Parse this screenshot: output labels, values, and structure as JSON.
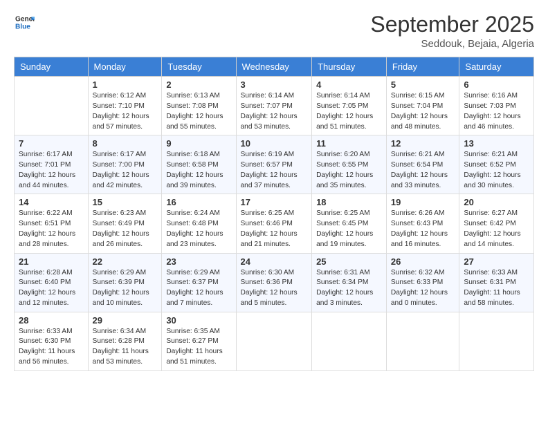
{
  "logo": {
    "line1": "General",
    "line2": "Blue"
  },
  "header": {
    "month": "September 2025",
    "location": "Seddouk, Bejaia, Algeria"
  },
  "weekdays": [
    "Sunday",
    "Monday",
    "Tuesday",
    "Wednesday",
    "Thursday",
    "Friday",
    "Saturday"
  ],
  "weeks": [
    [
      {
        "day": "",
        "info": ""
      },
      {
        "day": "1",
        "info": "Sunrise: 6:12 AM\nSunset: 7:10 PM\nDaylight: 12 hours\nand 57 minutes."
      },
      {
        "day": "2",
        "info": "Sunrise: 6:13 AM\nSunset: 7:08 PM\nDaylight: 12 hours\nand 55 minutes."
      },
      {
        "day": "3",
        "info": "Sunrise: 6:14 AM\nSunset: 7:07 PM\nDaylight: 12 hours\nand 53 minutes."
      },
      {
        "day": "4",
        "info": "Sunrise: 6:14 AM\nSunset: 7:05 PM\nDaylight: 12 hours\nand 51 minutes."
      },
      {
        "day": "5",
        "info": "Sunrise: 6:15 AM\nSunset: 7:04 PM\nDaylight: 12 hours\nand 48 minutes."
      },
      {
        "day": "6",
        "info": "Sunrise: 6:16 AM\nSunset: 7:03 PM\nDaylight: 12 hours\nand 46 minutes."
      }
    ],
    [
      {
        "day": "7",
        "info": "Sunrise: 6:17 AM\nSunset: 7:01 PM\nDaylight: 12 hours\nand 44 minutes."
      },
      {
        "day": "8",
        "info": "Sunrise: 6:17 AM\nSunset: 7:00 PM\nDaylight: 12 hours\nand 42 minutes."
      },
      {
        "day": "9",
        "info": "Sunrise: 6:18 AM\nSunset: 6:58 PM\nDaylight: 12 hours\nand 39 minutes."
      },
      {
        "day": "10",
        "info": "Sunrise: 6:19 AM\nSunset: 6:57 PM\nDaylight: 12 hours\nand 37 minutes."
      },
      {
        "day": "11",
        "info": "Sunrise: 6:20 AM\nSunset: 6:55 PM\nDaylight: 12 hours\nand 35 minutes."
      },
      {
        "day": "12",
        "info": "Sunrise: 6:21 AM\nSunset: 6:54 PM\nDaylight: 12 hours\nand 33 minutes."
      },
      {
        "day": "13",
        "info": "Sunrise: 6:21 AM\nSunset: 6:52 PM\nDaylight: 12 hours\nand 30 minutes."
      }
    ],
    [
      {
        "day": "14",
        "info": "Sunrise: 6:22 AM\nSunset: 6:51 PM\nDaylight: 12 hours\nand 28 minutes."
      },
      {
        "day": "15",
        "info": "Sunrise: 6:23 AM\nSunset: 6:49 PM\nDaylight: 12 hours\nand 26 minutes."
      },
      {
        "day": "16",
        "info": "Sunrise: 6:24 AM\nSunset: 6:48 PM\nDaylight: 12 hours\nand 23 minutes."
      },
      {
        "day": "17",
        "info": "Sunrise: 6:25 AM\nSunset: 6:46 PM\nDaylight: 12 hours\nand 21 minutes."
      },
      {
        "day": "18",
        "info": "Sunrise: 6:25 AM\nSunset: 6:45 PM\nDaylight: 12 hours\nand 19 minutes."
      },
      {
        "day": "19",
        "info": "Sunrise: 6:26 AM\nSunset: 6:43 PM\nDaylight: 12 hours\nand 16 minutes."
      },
      {
        "day": "20",
        "info": "Sunrise: 6:27 AM\nSunset: 6:42 PM\nDaylight: 12 hours\nand 14 minutes."
      }
    ],
    [
      {
        "day": "21",
        "info": "Sunrise: 6:28 AM\nSunset: 6:40 PM\nDaylight: 12 hours\nand 12 minutes."
      },
      {
        "day": "22",
        "info": "Sunrise: 6:29 AM\nSunset: 6:39 PM\nDaylight: 12 hours\nand 10 minutes."
      },
      {
        "day": "23",
        "info": "Sunrise: 6:29 AM\nSunset: 6:37 PM\nDaylight: 12 hours\nand 7 minutes."
      },
      {
        "day": "24",
        "info": "Sunrise: 6:30 AM\nSunset: 6:36 PM\nDaylight: 12 hours\nand 5 minutes."
      },
      {
        "day": "25",
        "info": "Sunrise: 6:31 AM\nSunset: 6:34 PM\nDaylight: 12 hours\nand 3 minutes."
      },
      {
        "day": "26",
        "info": "Sunrise: 6:32 AM\nSunset: 6:33 PM\nDaylight: 12 hours\nand 0 minutes."
      },
      {
        "day": "27",
        "info": "Sunrise: 6:33 AM\nSunset: 6:31 PM\nDaylight: 11 hours\nand 58 minutes."
      }
    ],
    [
      {
        "day": "28",
        "info": "Sunrise: 6:33 AM\nSunset: 6:30 PM\nDaylight: 11 hours\nand 56 minutes."
      },
      {
        "day": "29",
        "info": "Sunrise: 6:34 AM\nSunset: 6:28 PM\nDaylight: 11 hours\nand 53 minutes."
      },
      {
        "day": "30",
        "info": "Sunrise: 6:35 AM\nSunset: 6:27 PM\nDaylight: 11 hours\nand 51 minutes."
      },
      {
        "day": "",
        "info": ""
      },
      {
        "day": "",
        "info": ""
      },
      {
        "day": "",
        "info": ""
      },
      {
        "day": "",
        "info": ""
      }
    ]
  ]
}
